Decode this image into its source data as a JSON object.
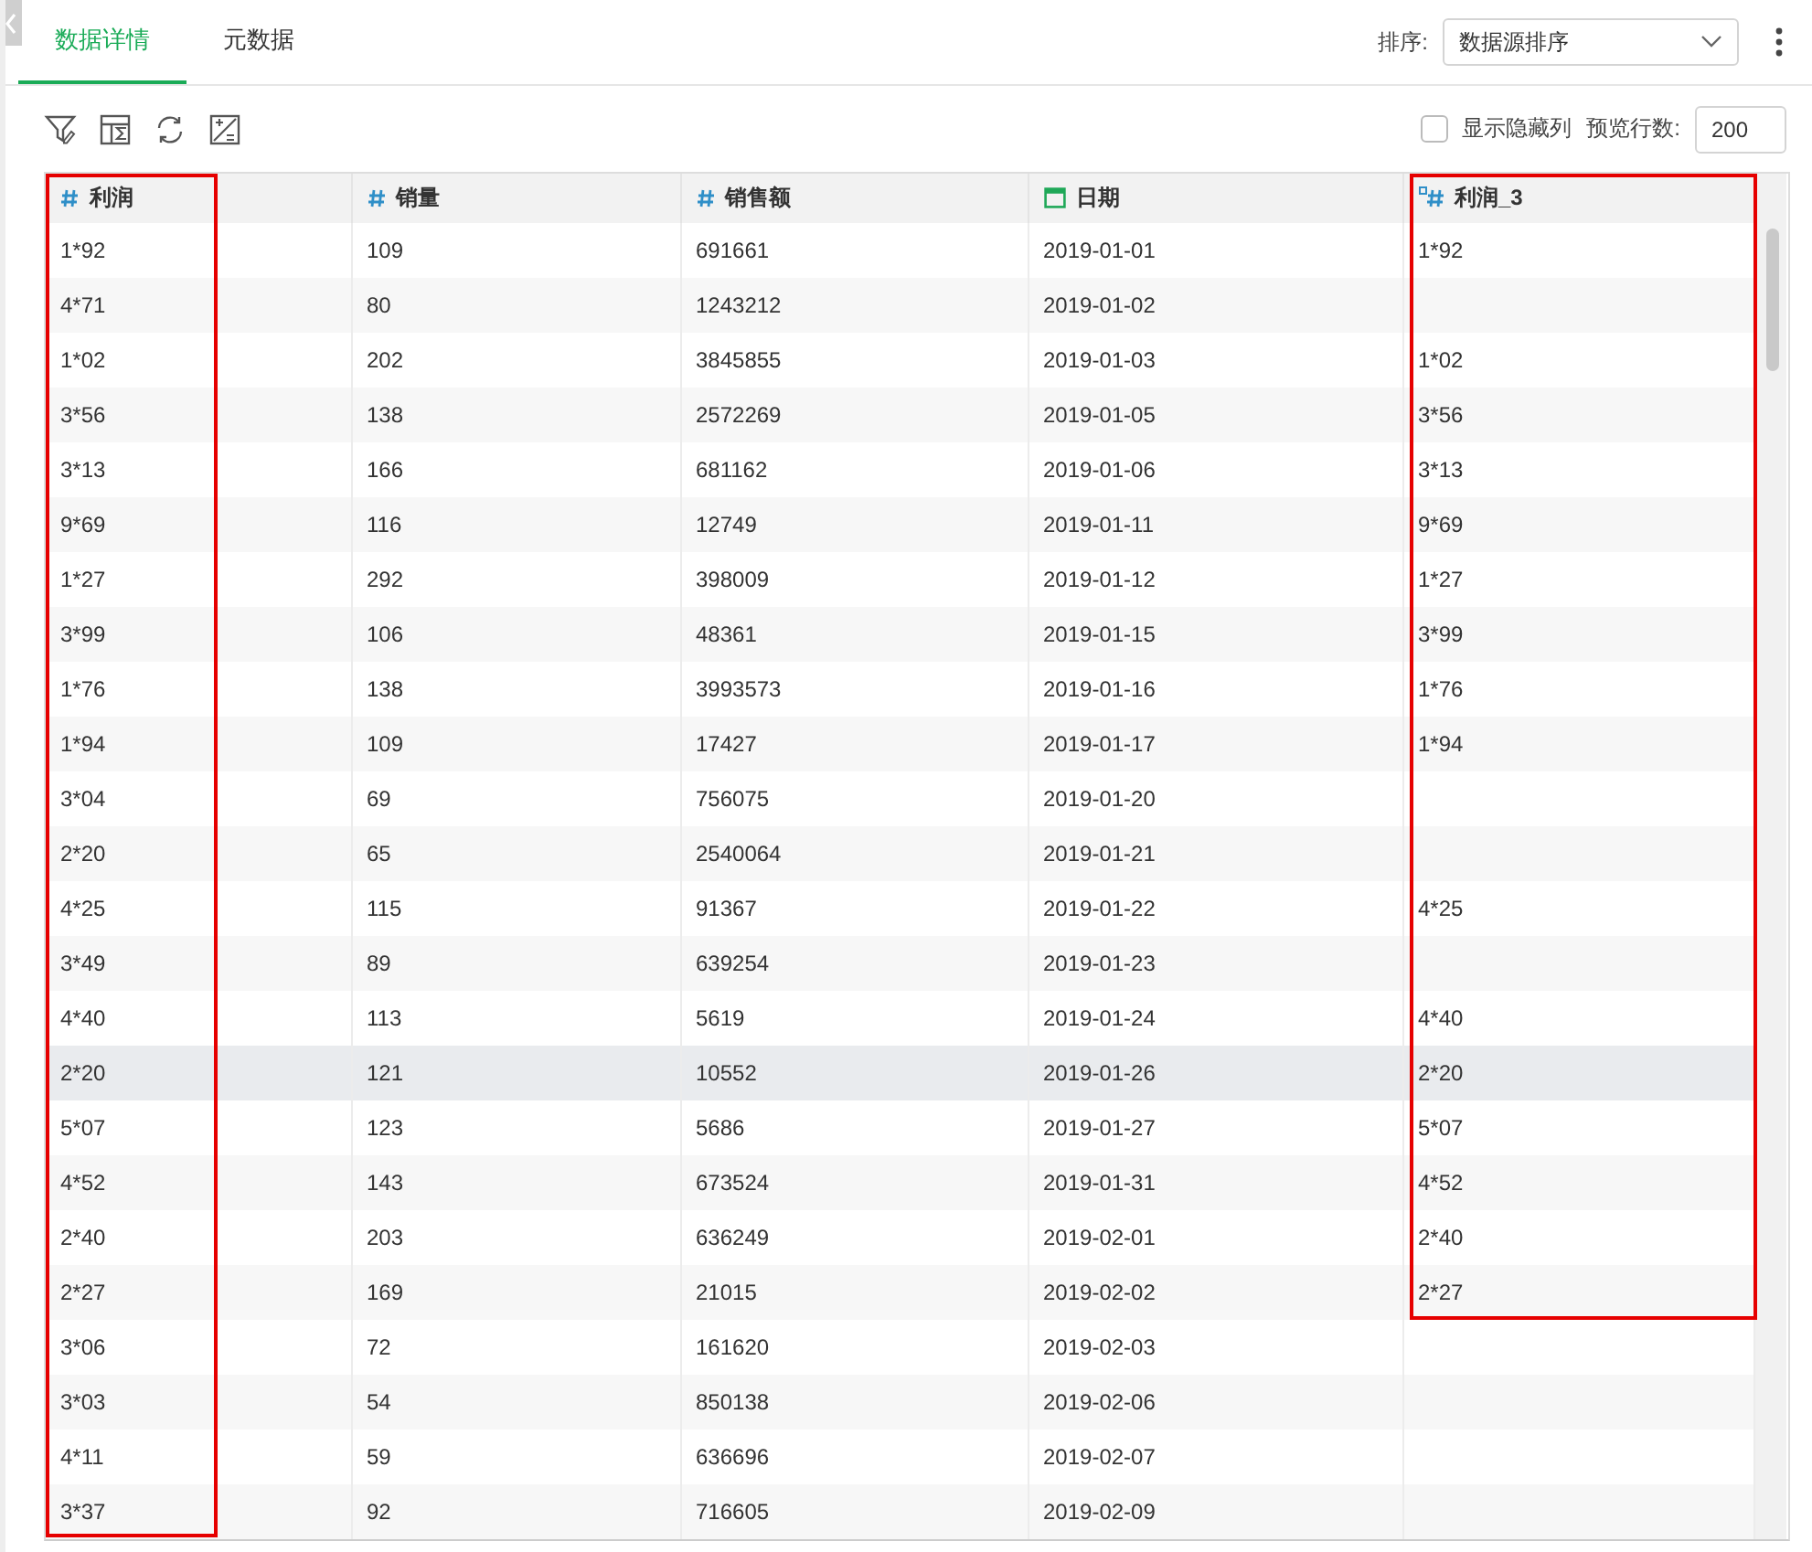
{
  "tabs": [
    {
      "label": "数据详情",
      "selected": true
    },
    {
      "label": "元数据",
      "selected": false
    }
  ],
  "sort": {
    "label": "排序:",
    "value": "数据源排序"
  },
  "toolbar": {
    "show_hidden": {
      "label": "显示隐藏列",
      "checked": false
    },
    "preview": {
      "label": "预览行数:",
      "value": "200"
    }
  },
  "columns": [
    {
      "name": "利润",
      "kind": "number",
      "framed": true
    },
    {
      "name": "销量",
      "kind": "number",
      "framed": false
    },
    {
      "name": "销售额",
      "kind": "number",
      "framed": false
    },
    {
      "name": "日期",
      "kind": "date",
      "framed": false
    },
    {
      "name": "利润_3",
      "kind": "calculated",
      "framed": true
    }
  ],
  "rows": [
    {
      "hovered": false,
      "in_frame": true,
      "cells": [
        "1*92",
        "109",
        "691661",
        "2019-01-01",
        "1*92"
      ]
    },
    {
      "hovered": false,
      "in_frame": true,
      "cells": [
        "4*71",
        "80",
        "1243212",
        "2019-01-02",
        ""
      ]
    },
    {
      "hovered": false,
      "in_frame": true,
      "cells": [
        "1*02",
        "202",
        "3845855",
        "2019-01-03",
        "1*02"
      ]
    },
    {
      "hovered": false,
      "in_frame": true,
      "cells": [
        "3*56",
        "138",
        "2572269",
        "2019-01-05",
        "3*56"
      ]
    },
    {
      "hovered": false,
      "in_frame": true,
      "cells": [
        "3*13",
        "166",
        "681162",
        "2019-01-06",
        "3*13"
      ]
    },
    {
      "hovered": false,
      "in_frame": true,
      "cells": [
        "9*69",
        "116",
        "12749",
        "2019-01-11",
        "9*69"
      ]
    },
    {
      "hovered": false,
      "in_frame": true,
      "cells": [
        "1*27",
        "292",
        "398009",
        "2019-01-12",
        "1*27"
      ]
    },
    {
      "hovered": false,
      "in_frame": true,
      "cells": [
        "3*99",
        "106",
        "48361",
        "2019-01-15",
        "3*99"
      ]
    },
    {
      "hovered": false,
      "in_frame": true,
      "cells": [
        "1*76",
        "138",
        "3993573",
        "2019-01-16",
        "1*76"
      ]
    },
    {
      "hovered": false,
      "in_frame": true,
      "cells": [
        "1*94",
        "109",
        "17427",
        "2019-01-17",
        "1*94"
      ]
    },
    {
      "hovered": false,
      "in_frame": true,
      "cells": [
        "3*04",
        "69",
        "756075",
        "2019-01-20",
        ""
      ]
    },
    {
      "hovered": false,
      "in_frame": true,
      "cells": [
        "2*20",
        "65",
        "2540064",
        "2019-01-21",
        ""
      ]
    },
    {
      "hovered": false,
      "in_frame": true,
      "cells": [
        "4*25",
        "115",
        "91367",
        "2019-01-22",
        "4*25"
      ]
    },
    {
      "hovered": false,
      "in_frame": true,
      "cells": [
        "3*49",
        "89",
        "639254",
        "2019-01-23",
        ""
      ]
    },
    {
      "hovered": false,
      "in_frame": true,
      "cells": [
        "4*40",
        "113",
        "5619",
        "2019-01-24",
        "4*40"
      ]
    },
    {
      "hovered": true,
      "in_frame": true,
      "cells": [
        "2*20",
        "121",
        "10552",
        "2019-01-26",
        "2*20"
      ]
    },
    {
      "hovered": false,
      "in_frame": true,
      "cells": [
        "5*07",
        "123",
        "5686",
        "2019-01-27",
        "5*07"
      ]
    },
    {
      "hovered": false,
      "in_frame": true,
      "cells": [
        "4*52",
        "143",
        "673524",
        "2019-01-31",
        "4*52"
      ]
    },
    {
      "hovered": false,
      "in_frame": true,
      "cells": [
        "2*40",
        "203",
        "636249",
        "2019-02-01",
        "2*40"
      ]
    },
    {
      "hovered": false,
      "in_frame": true,
      "cells": [
        "2*27",
        "169",
        "21015",
        "2019-02-02",
        "2*27"
      ]
    },
    {
      "hovered": false,
      "in_frame": false,
      "cells": [
        "3*06",
        "72",
        "161620",
        "2019-02-03",
        ""
      ]
    },
    {
      "hovered": false,
      "in_frame": false,
      "cells": [
        "3*03",
        "54",
        "850138",
        "2019-02-06",
        ""
      ]
    },
    {
      "hovered": false,
      "in_frame": false,
      "cells": [
        "4*11",
        "59",
        "636696",
        "2019-02-07",
        ""
      ]
    },
    {
      "hovered": false,
      "in_frame": false,
      "cells": [
        "3*37",
        "92",
        "716605",
        "2019-02-09",
        ""
      ]
    }
  ]
}
